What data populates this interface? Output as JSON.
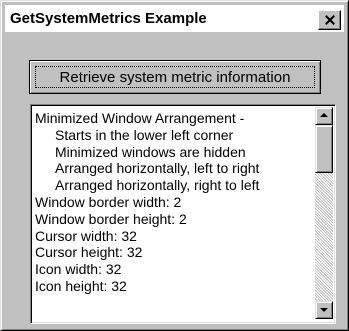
{
  "window": {
    "title": "GetSystemMetrics Example",
    "close_glyph": "close-icon"
  },
  "toolbar": {
    "retrieve_label": "Retrieve system metric information"
  },
  "metrics_list": {
    "items": [
      {
        "text": "Minimized Window Arrangement -",
        "indent": false
      },
      {
        "text": "Starts in the lower left corner",
        "indent": true
      },
      {
        "text": "Minimized windows are hidden",
        "indent": true
      },
      {
        "text": "Arranged horizontally, left to right",
        "indent": true
      },
      {
        "text": "Arranged horizontally, right to left",
        "indent": true
      },
      {
        "text": "Window border width: 2",
        "indent": false
      },
      {
        "text": "Window border height: 2",
        "indent": false
      },
      {
        "text": "Cursor width: 32",
        "indent": false
      },
      {
        "text": "Cursor height: 32",
        "indent": false
      },
      {
        "text": "Icon width: 32",
        "indent": false
      },
      {
        "text": "Icon height: 32",
        "indent": false
      }
    ]
  },
  "scrollbar": {
    "up_icon": "chevron-up-icon",
    "down_icon": "chevron-down-icon"
  },
  "colors": {
    "face": "#c0c0c0",
    "highlight": "#ffffff",
    "shadow": "#808080",
    "text": "#000000"
  }
}
